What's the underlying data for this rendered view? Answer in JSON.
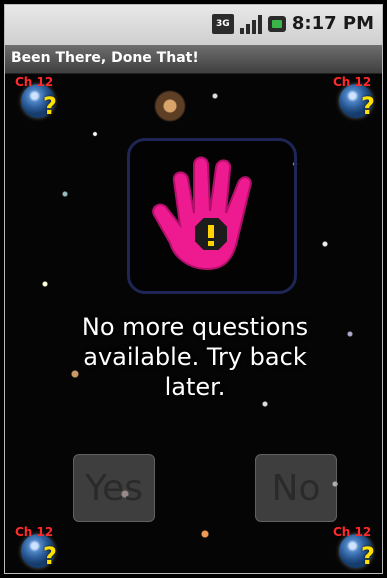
{
  "status_bar": {
    "network_type": "3G",
    "time": "8:17 PM",
    "icons": [
      "network-3g-icon",
      "signal-strength-icon",
      "battery-icon"
    ]
  },
  "app": {
    "title": "Been There, Done That!"
  },
  "badges": {
    "label": "Ch 12",
    "icon": "earth-question-icon"
  },
  "main": {
    "icon": "hand-warning-icon",
    "message_line1": "No more questions",
    "message_line2": "available. Try back",
    "message_line3": "later."
  },
  "buttons": {
    "yes": "Yes",
    "no": "No"
  },
  "colors": {
    "hand": "#ee1a8f",
    "warning_yellow": "#ffd400",
    "badge_label": "#ff2a2a",
    "title_bar": "#555555"
  }
}
